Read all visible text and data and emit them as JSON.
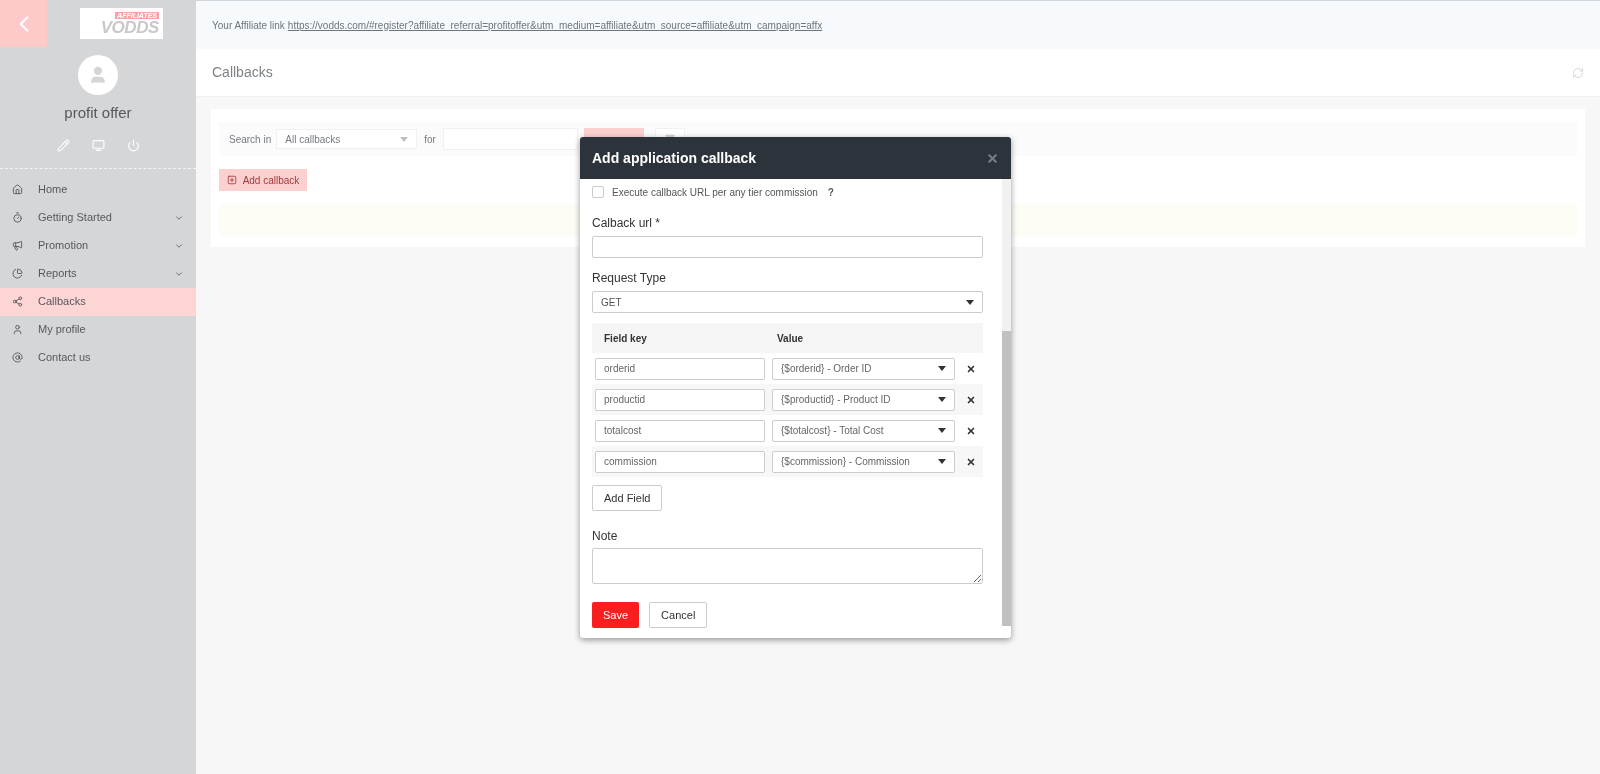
{
  "sidebar": {
    "logo": {
      "top_text": "AFFILIATES",
      "main_text": "VODDS"
    },
    "user": {
      "name": "profit offer"
    },
    "items": [
      {
        "label": "Home",
        "selected": false,
        "expandable": false
      },
      {
        "label": "Getting Started",
        "selected": false,
        "expandable": true
      },
      {
        "label": "Promotion",
        "selected": false,
        "expandable": true
      },
      {
        "label": "Reports",
        "selected": false,
        "expandable": true
      },
      {
        "label": "Callbacks",
        "selected": true,
        "expandable": false
      },
      {
        "label": "My profile",
        "selected": false,
        "expandable": false
      },
      {
        "label": "Contact us",
        "selected": false,
        "expandable": false
      }
    ]
  },
  "top_bar": {
    "text": "Your Affiliate link",
    "link": "https://vodds.com/#register?affiliate_referral=profitoffer&utm_medium=affiliate&utm_source=affiliate&utm_campaign=affx"
  },
  "page": {
    "title": "Callbacks",
    "search_in_label": "Search in",
    "scope": "All callbacks",
    "for_label": "for",
    "add_button": "Add callback"
  },
  "modal": {
    "title": "Add application callback",
    "checkbox": {
      "label": "Execute callback URL per any tier commission",
      "checked": false,
      "help": "?"
    },
    "url_label": "Calback url *",
    "request_type": {
      "label": "Request Type",
      "value": "GET"
    },
    "columns": [
      "Field key",
      "Value"
    ],
    "rows": [
      {
        "key": "orderid",
        "value": "{$orderid} - Order ID"
      },
      {
        "key": "productid",
        "value": "{$productid} - Product ID"
      },
      {
        "key": "totalcost",
        "value": "{$totalcost} - Total Cost"
      },
      {
        "key": "commission",
        "value": "{$commission} - Commission"
      }
    ],
    "add_field_button": "Add Field",
    "note_label": "Note",
    "save_button": "Save",
    "cancel_button": "Cancel"
  }
}
